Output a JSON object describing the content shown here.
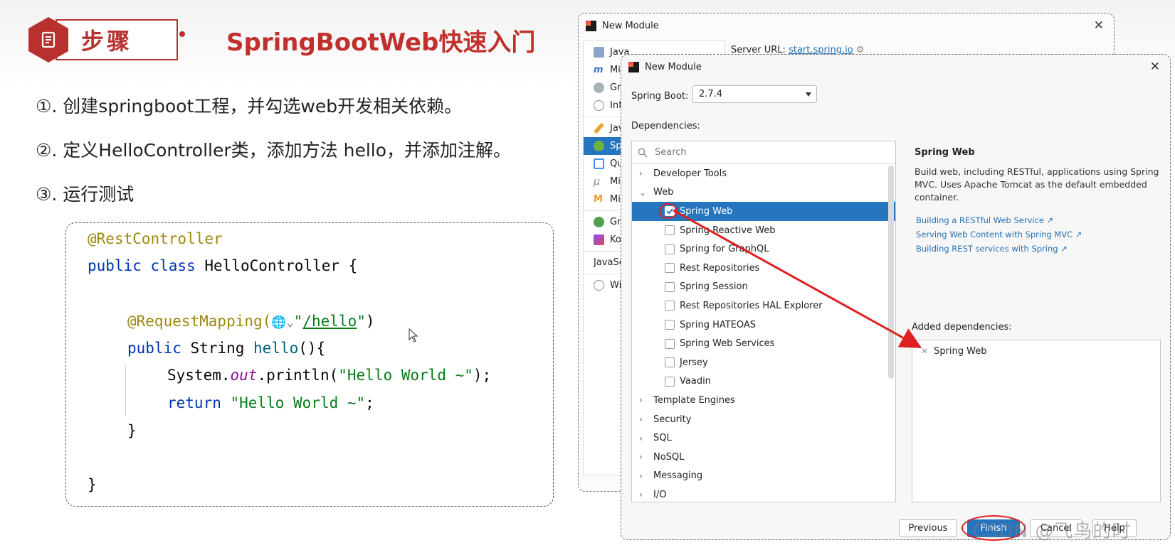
{
  "slide": {
    "badge": "步骤",
    "title": "SpringBootWeb快速入门",
    "steps": [
      "①. 创建springboot工程，并勾选web开发相关依赖。",
      "②. 定义HelloController类，添加方法 hello，并添加注解。",
      "③. 运行测试"
    ],
    "code": {
      "l1": "@RestController",
      "l2_kw": "public class ",
      "l2_name": "HelloController {",
      "l3_anno": "@RequestMapping(",
      "l3_globe": "🌐⌄",
      "l3_q1": "\"",
      "l3_url": "/hello",
      "l3_q2": "\"",
      "l3_close": ")",
      "l4_kw": "public ",
      "l4_type": "String ",
      "l4_method": "hello",
      "l4_rest": "(){",
      "l5_a": "System.",
      "l5_b": "out",
      "l5_c": ".println(",
      "l5_str": "\"Hello World ~\"",
      "l5_end": ");",
      "l6_kw": "return ",
      "l6_str": "\"Hello World ~\"",
      "l6_end": ";",
      "l7": "}",
      "l8": "}"
    }
  },
  "dialog_back": {
    "title": "New Module",
    "server_label": "Server URL: ",
    "server_url": "start.spring.io",
    "items": [
      "Java",
      "Mi",
      "Gr",
      "Inf",
      "Jav",
      "Sp",
      "Qu",
      "Mi",
      "Mi",
      "Gr",
      "Ko",
      "JavaSc",
      "Wi"
    ]
  },
  "dialog_front": {
    "title": "New Module",
    "boot_label": "Spring Boot:",
    "boot_version": "2.7.4",
    "deps_label": "Dependencies:",
    "search_placeholder": "Search",
    "tree": {
      "developer_tools": "Developer Tools",
      "web": "Web",
      "web_children": [
        "Spring Web",
        "Spring Reactive Web",
        "Spring for GraphQL",
        "Rest Repositories",
        "Spring Session",
        "Rest Repositories HAL Explorer",
        "Spring HATEOAS",
        "Spring Web Services",
        "Jersey",
        "Vaadin"
      ],
      "after": [
        "Template Engines",
        "Security",
        "SQL",
        "NoSQL",
        "Messaging",
        "I/O"
      ]
    },
    "info": {
      "title": "Spring Web",
      "description": "Build web, including RESTful, applications using Spring MVC. Uses Apache Tomcat as the default embedded container.",
      "links": [
        "Building a RESTful Web Service ↗",
        "Serving Web Content with Spring MVC ↗",
        "Building REST services with Spring ↗"
      ]
    },
    "added_label": "Added dependencies:",
    "added_items": [
      "Spring Web"
    ],
    "buttons": {
      "previous": "Previous",
      "finish": "Finish",
      "cancel": "Cancel",
      "help": "Help"
    },
    "watermark": "CSDN @飞鸟的时"
  },
  "colors": {
    "accent_red": "#b8312f",
    "selection_blue": "#2675bf",
    "annotation_red": "#e02020"
  }
}
